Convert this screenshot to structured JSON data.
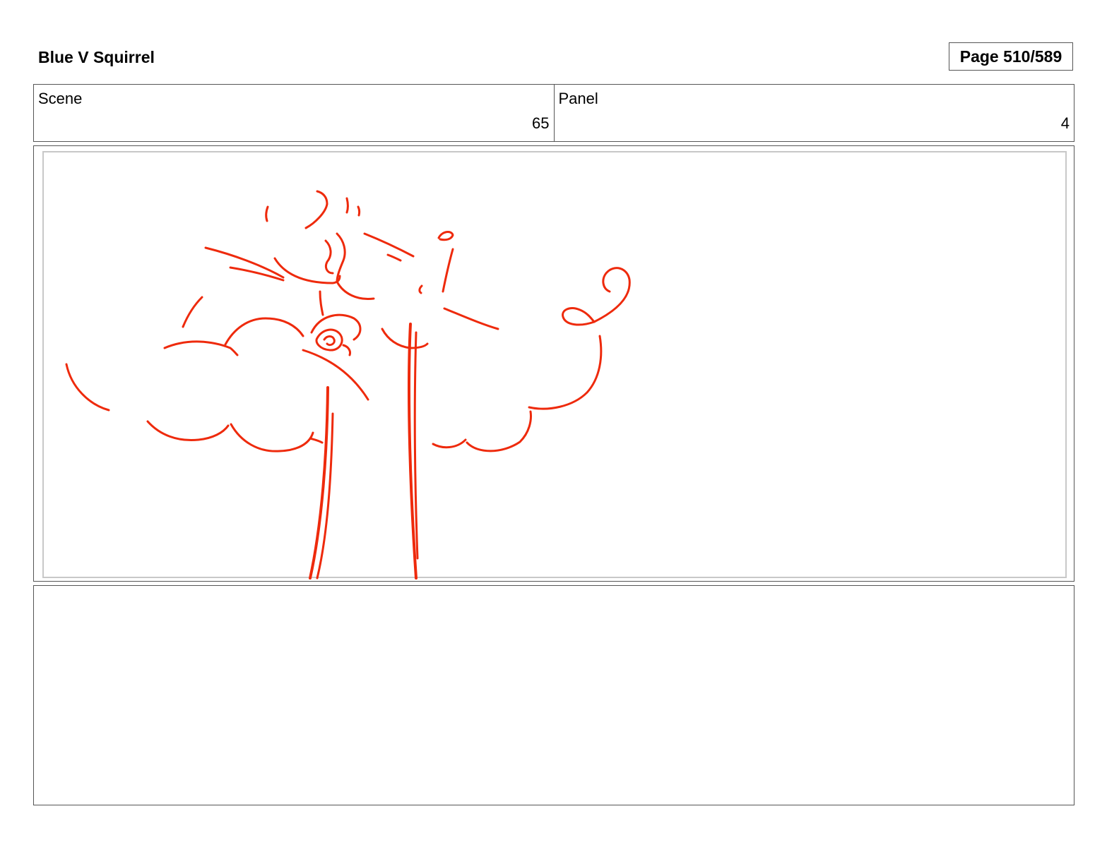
{
  "header": {
    "title": "Blue V Squirrel",
    "page_label": "Page 510/589"
  },
  "info": {
    "scene_label": "Scene",
    "scene_value": "65",
    "panel_label": "Panel",
    "panel_value": "4"
  },
  "colors": {
    "sketch_stroke": "#ee2a0c"
  },
  "notes": {
    "text": ""
  }
}
